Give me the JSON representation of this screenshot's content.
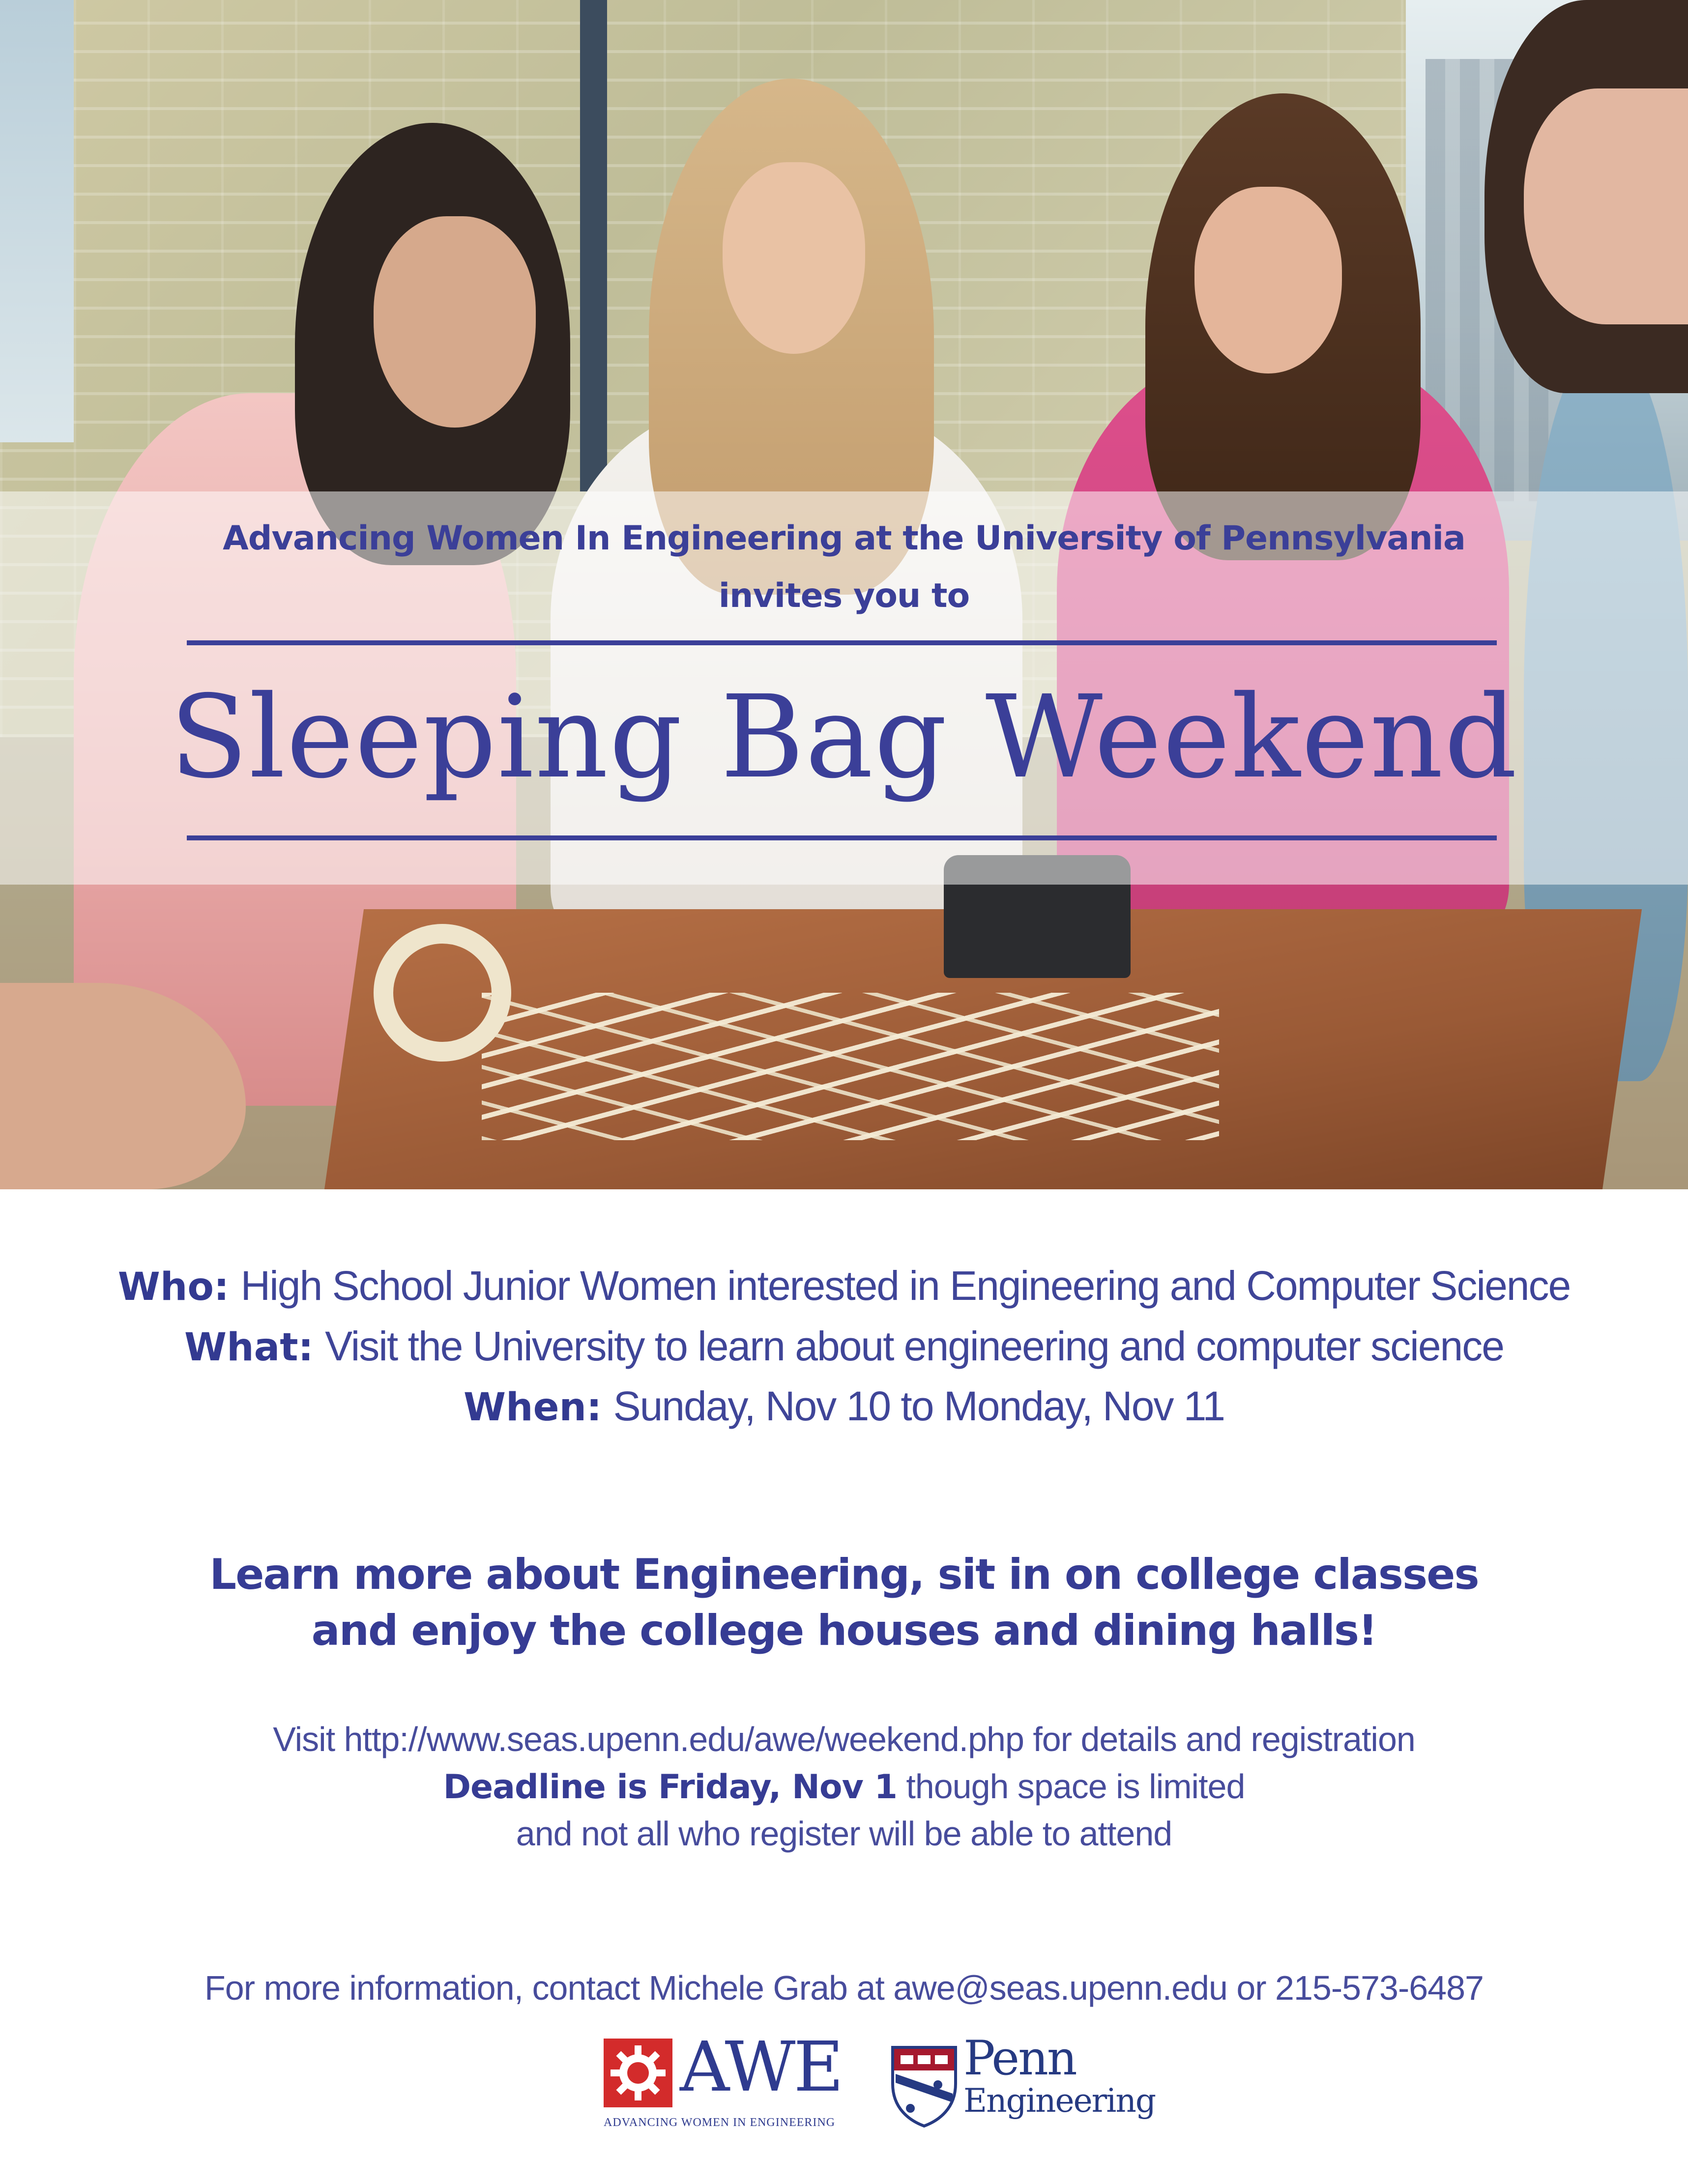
{
  "hero": {
    "photo_subject": "four young women building a structure from sticks and tape at a table"
  },
  "banner": {
    "sponsor": "Advancing Women In Engineering at the University of Pennsylvania",
    "invites": "invites you to",
    "title": "Sleeping Bag Weekend"
  },
  "details": {
    "who_label": "Who:",
    "who_value": "High School Junior Women interested in Engineering and Computer Science",
    "what_label": "What:",
    "what_value": "Visit the University to learn about engineering and computer science",
    "when_label": "When:",
    "when_value": "Sunday, Nov 10 to Monday, Nov 11"
  },
  "learn": {
    "line1": "Learn more about Engineering, sit in on college classes",
    "line2": "and enjoy the college houses and dining halls!"
  },
  "registration": {
    "visit_line": "Visit http://www.seas.upenn.edu/awe/weekend.php for details and registration",
    "deadline_bold": "Deadline is Friday, Nov 1",
    "deadline_rest": " though space is limited",
    "limit_line": "and not all who register will be able to attend"
  },
  "contact": {
    "line": "For more information, contact Michele Grab at awe@seas.upenn.edu or 215-573-6487"
  },
  "logos": {
    "awe_text": "AWE",
    "awe_subtitle": "ADVANCING WOMEN IN ENGINEERING",
    "penn_name": "Penn",
    "penn_sub": "Engineering"
  },
  "colors": {
    "primary": "#3b3f98",
    "awe_red": "#d32b2b",
    "penn_blue": "#263a82",
    "penn_red": "#a6192e"
  }
}
